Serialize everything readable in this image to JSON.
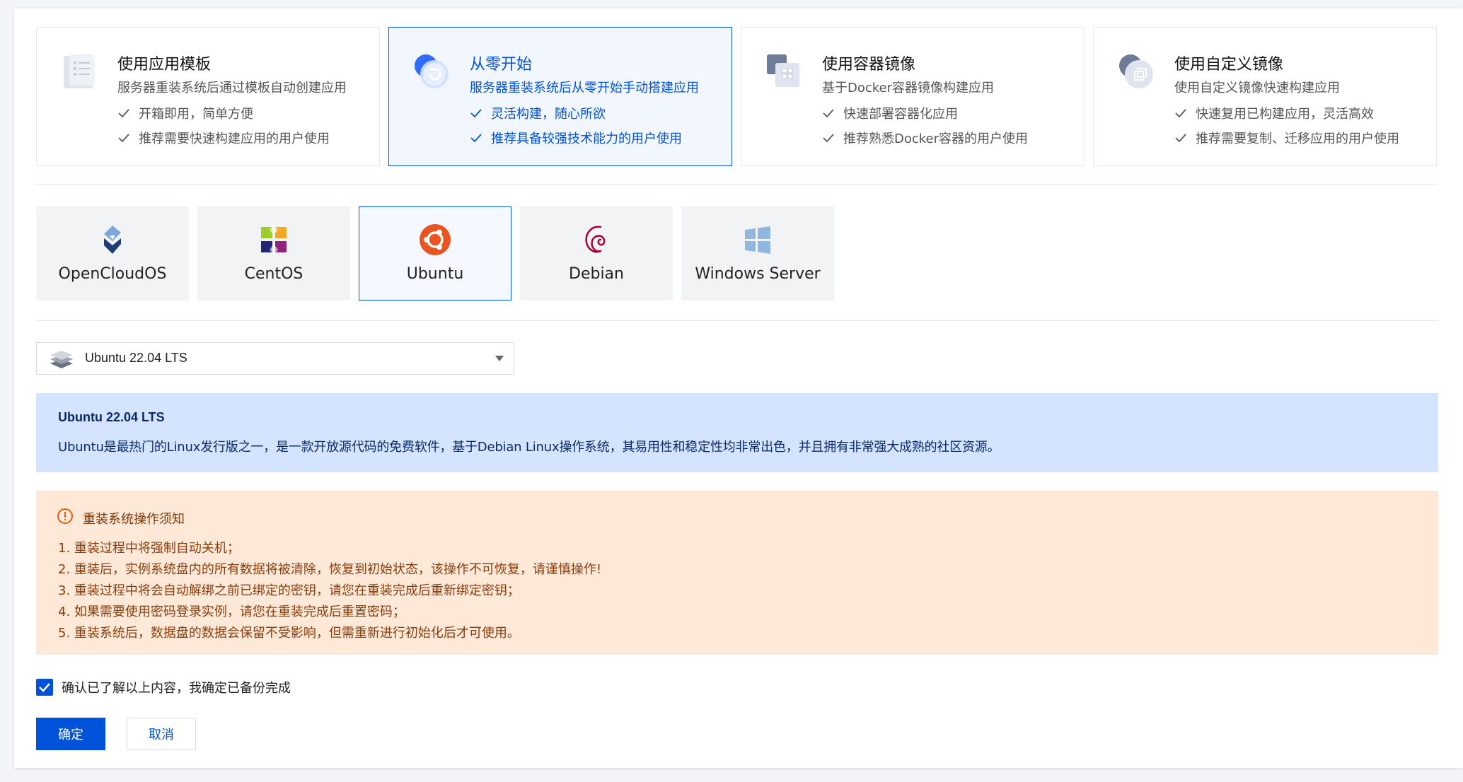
{
  "modes": [
    {
      "title": "使用应用模板",
      "desc": "服务器重装系统后通过模板自动创建应用",
      "features": [
        "开箱即用，简单方便",
        "推荐需要快速构建应用的用户使用"
      ]
    },
    {
      "title": "从零开始",
      "desc": "服务器重装系统后从零开始手动搭建应用",
      "features": [
        "灵活构建，随心所欲",
        "推荐具备较强技术能力的用户使用"
      ]
    },
    {
      "title": "使用容器镜像",
      "desc": "基于Docker容器镜像构建应用",
      "features": [
        "快速部署容器化应用",
        "推荐熟悉Docker容器的用户使用"
      ]
    },
    {
      "title": "使用自定义镜像",
      "desc": "使用自定义镜像快速构建应用",
      "features": [
        "快速复用已构建应用，灵活高效",
        "推荐需要复制、迁移应用的用户使用"
      ]
    }
  ],
  "os_list": [
    {
      "name": "OpenCloudOS"
    },
    {
      "name": "CentOS"
    },
    {
      "name": "Ubuntu"
    },
    {
      "name": "Debian"
    },
    {
      "name": "Windows Server"
    }
  ],
  "version_select": {
    "value": "Ubuntu 22.04 LTS"
  },
  "info": {
    "title": "Ubuntu 22.04 LTS",
    "desc": "Ubuntu是最热门的Linux发行版之一，是一款开放源代码的免费软件，基于Debian Linux操作系统，其易用性和稳定性均非常出色，并且拥有非常强大成熟的社区资源。"
  },
  "warning": {
    "title": "重装系统操作须知",
    "items": [
      "1. 重装过程中将强制自动关机；",
      "2. 重装后，实例系统盘内的所有数据将被清除，恢复到初始状态，该操作不可恢复，请谨慎操作!",
      "3. 重装过程中将会自动解绑之前已绑定的密钥，请您在重装完成后重新绑定密钥；",
      "4. 如果需要使用密码登录实例，请您在重装完成后重置密码；",
      "5. 重装系统后，数据盘的数据会保留不受影响，但需重新进行初始化后才可使用。"
    ]
  },
  "confirm": {
    "label": "确认已了解以上内容，我确定已备份完成"
  },
  "buttons": {
    "ok": "确定",
    "cancel": "取消"
  },
  "colors": {
    "accent": "#0052d9",
    "info_bg": "#d4e4ff",
    "warn_bg": "#fee8d8",
    "ubuntu": "#e95420"
  }
}
